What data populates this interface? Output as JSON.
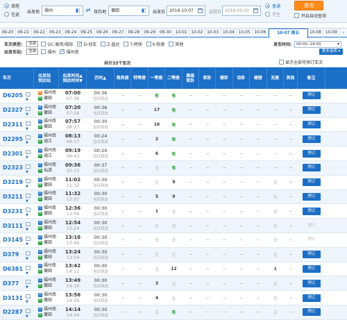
{
  "search": {
    "trip_types": [
      {
        "label": "单程",
        "selected": true
      },
      {
        "label": "往返",
        "selected": false
      }
    ],
    "from_label": "出发地",
    "from_value": "福州",
    "to_label": "目的地",
    "to_value": "莆田",
    "depart_label": "出发日",
    "depart_value": "2016-10-07",
    "return_label": "返程日",
    "return_value": "2016-09-20",
    "passenger_types": [
      {
        "label": "普通",
        "selected": true
      },
      {
        "label": "学生",
        "selected": false
      }
    ],
    "query_button": "查询",
    "auto_query_label": "开启自动查询"
  },
  "date_tabs": {
    "prev_dates": [
      "09-20",
      "09-21",
      "09-22",
      "09-23",
      "09-24",
      "09-25",
      "09-26",
      "09-27",
      "09-28",
      "09-29",
      "09-30",
      "10-01",
      "10-02",
      "10-03",
      "10-04",
      "10-05",
      "10-06"
    ],
    "active": "10-07 周五",
    "next_dates": [
      "10-08",
      "10-09"
    ]
  },
  "filters": {
    "type_title": "车次类型:",
    "all_label": "全部",
    "types": [
      {
        "label": "GC-高铁/城际",
        "checked": false
      },
      {
        "label": "D-动车",
        "checked": true
      },
      {
        "label": "Z-直达",
        "checked": false
      },
      {
        "label": "T-特快",
        "checked": false
      },
      {
        "label": "K-快速",
        "checked": false
      },
      {
        "label": "其他",
        "checked": false
      }
    ],
    "station_title": "出发车站:",
    "stations": [
      {
        "label": "福州",
        "checked": false
      },
      {
        "label": "福州南",
        "checked": true
      }
    ],
    "time_label": "发车时间:",
    "time_value": "00:00--24:00",
    "more_button": "更多选项 ▾"
  },
  "summary": {
    "total_text": "共计33个车次",
    "show_all_label": "显示全部可预订车次"
  },
  "table": {
    "headers": [
      "车次",
      "出发站\n到达站",
      "出发时间▲\n到达时间▼",
      "历时▲",
      "商务座",
      "特等座",
      "一等座",
      "二等座",
      "高级\n软卧",
      "软卧",
      "硬卧",
      "动卧",
      "硬座",
      "无座",
      "其他",
      "备注"
    ],
    "book_label": "预订",
    "rows": [
      {
        "train": "D6205",
        "from": "福州南",
        "from_type": "start",
        "to": "莆田",
        "dep": "07:00",
        "arr": "07:36",
        "dur": "00:36",
        "day": "当日到达",
        "seats": [
          "--",
          "--",
          "有",
          "有",
          "--",
          "--",
          "--",
          "--",
          "--",
          "--",
          "--"
        ],
        "bookable": true
      },
      {
        "train": "D2327",
        "from": "福州南",
        "from_type": "pass",
        "to": "莆田",
        "dep": "07:20",
        "arr": "07:56",
        "dur": "00:36",
        "day": "当日到达",
        "seats": [
          "--",
          "--",
          "17",
          "有",
          "--",
          "--",
          "--",
          "--",
          "--",
          "--",
          "--"
        ],
        "bookable": true
      },
      {
        "train": "D2311",
        "from": "福州南",
        "from_type": "pass",
        "to": "莆田",
        "dep": "07:57",
        "arr": "08:27",
        "dur": "00:30",
        "day": "当日到达",
        "seats": [
          "--",
          "--",
          "16",
          "有",
          "--",
          "--",
          "--",
          "--",
          "--",
          "--",
          "--"
        ],
        "bookable": true
      },
      {
        "train": "D2295",
        "from": "福州南",
        "from_type": "pass",
        "to": "涵江",
        "dep": "08:13",
        "arr": "08:37",
        "dur": "00:24",
        "day": "当日到达",
        "seats": [
          "--",
          "--",
          "2",
          "有",
          "--",
          "--",
          "--",
          "--",
          "--",
          "--",
          "--"
        ],
        "bookable": true
      },
      {
        "train": "D2301",
        "from": "福州南",
        "from_type": "pass",
        "to": "涵江",
        "dep": "09:19",
        "arr": "09:43",
        "dur": "00:24",
        "day": "当日到达",
        "seats": [
          "--",
          "--",
          "6",
          "有",
          "--",
          "--",
          "--",
          "--",
          "--",
          "--",
          "--"
        ],
        "bookable": true
      },
      {
        "train": "D2323",
        "from": "福州南",
        "from_type": "pass",
        "to": "仙游",
        "dep": "09:36",
        "arr": "10:13",
        "dur": "00:37",
        "day": "当日到达",
        "seats": [
          "--",
          "--",
          "无",
          "有",
          "--",
          "--",
          "--",
          "--",
          "--",
          "--",
          "--"
        ],
        "bookable": true
      },
      {
        "train": "D3219",
        "from": "福州南",
        "from_type": "pass",
        "to": "莆田",
        "dep": "11:02",
        "arr": "11:32",
        "dur": "00:30",
        "day": "当日到达",
        "seats": [
          "--",
          "--",
          "无",
          "9",
          "--",
          "--",
          "--",
          "--",
          "--",
          "无",
          "--"
        ],
        "bookable": true
      },
      {
        "train": "D3211",
        "from": "福州南",
        "from_type": "pass",
        "to": "莆田",
        "dep": "11:32",
        "arr": "12:02",
        "dur": "00:30",
        "day": "当日到达",
        "seats": [
          "--",
          "--",
          "5",
          "9",
          "--",
          "--",
          "--",
          "--",
          "--",
          "无",
          "--"
        ],
        "bookable": true
      },
      {
        "train": "D3231",
        "from": "福州南",
        "from_type": "pass",
        "to": "莆田",
        "dep": "12:36",
        "arr": "13:06",
        "dur": "00:30",
        "day": "当日到达",
        "seats": [
          "--",
          "--",
          "1",
          "无",
          "--",
          "--",
          "--",
          "--",
          "--",
          "无",
          "--"
        ],
        "bookable": true
      },
      {
        "train": "D3111",
        "from": "福州南",
        "from_type": "pass",
        "to": "莆田",
        "dep": "12:54",
        "arr": "13:24",
        "dur": "00:30",
        "day": "当日到达",
        "seats": [
          "--",
          "--",
          "无",
          "无",
          "--",
          "--",
          "--",
          "--",
          "--",
          "无",
          "--"
        ],
        "bookable": false
      },
      {
        "train": "D3145",
        "from": "福州南",
        "from_type": "pass",
        "to": "莆田",
        "dep": "13:16",
        "arr": "13:46",
        "dur": "00:30",
        "day": "当日到达",
        "seats": [
          "--",
          "--",
          "无",
          "无",
          "--",
          "--",
          "--",
          "--",
          "--",
          "无",
          "--"
        ],
        "bookable": false
      },
      {
        "train": "D379",
        "from": "福州南",
        "from_type": "pass",
        "to": "莆田",
        "dep": "13:24",
        "arr": "13:54",
        "dur": "00:30",
        "day": "当日到达",
        "seats": [
          "--",
          "--",
          "无",
          "无",
          "--",
          "--",
          "--",
          "--",
          "--",
          "无",
          "--"
        ],
        "bookable": true
      },
      {
        "train": "D6381",
        "from": "福州南",
        "from_type": "pass",
        "to": "莆田",
        "dep": "13:42",
        "arr": "14:12",
        "dur": "00:30",
        "day": "当日到达",
        "seats": [
          "--",
          "--",
          "无",
          "12",
          "--",
          "--",
          "--",
          "--",
          "--",
          "1",
          "--"
        ],
        "bookable": true
      },
      {
        "train": "D377",
        "from": "福州南",
        "from_type": "pass",
        "to": "莆田",
        "dep": "13:49",
        "arr": "14:19",
        "dur": "00:30",
        "day": "当日到达",
        "seats": [
          "--",
          "--",
          "3",
          "无",
          "--",
          "--",
          "--",
          "--",
          "--",
          "无",
          "--"
        ],
        "bookable": true
      },
      {
        "train": "D3131",
        "from": "福州南",
        "from_type": "pass",
        "to": "莆田",
        "dep": "13:56",
        "arr": "14:26",
        "dur": "00:30",
        "day": "当日到达",
        "seats": [
          "--",
          "--",
          "4",
          "无",
          "--",
          "--",
          "--",
          "--",
          "--",
          "无",
          "--"
        ],
        "bookable": true
      },
      {
        "train": "D2287",
        "from": "福州南",
        "from_type": "pass",
        "to": "莆田",
        "dep": "14:14",
        "arr": "14:44",
        "dur": "00:30",
        "day": "当日到达",
        "seats": [
          "--",
          "--",
          "无",
          "有",
          "--",
          "--",
          "--",
          "--",
          "--",
          "无",
          "--"
        ],
        "bookable": true
      }
    ]
  },
  "colors": {
    "accent": "#1b6fc7",
    "query_button": "#ff8b1a",
    "available": "#229a2e",
    "row_alt": "#eef5fc"
  }
}
